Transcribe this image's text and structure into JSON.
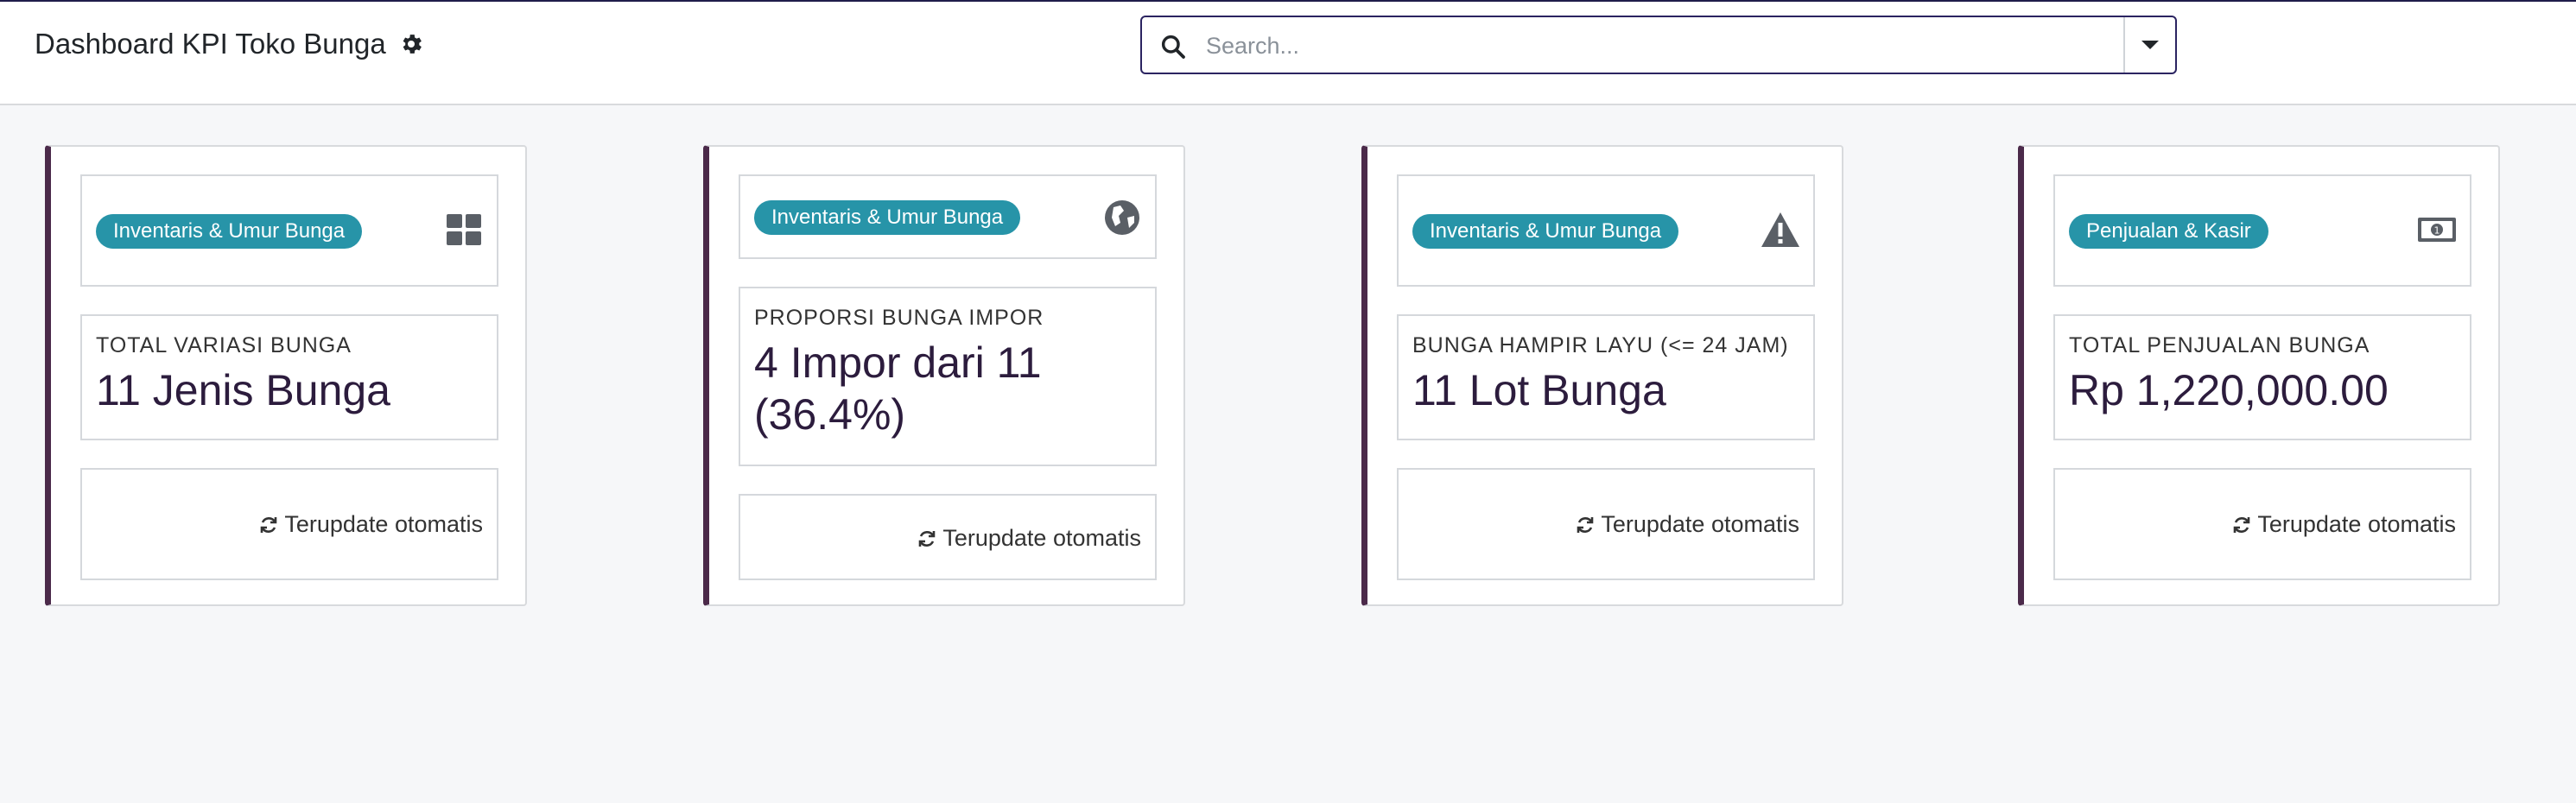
{
  "header": {
    "title": "Dashboard KPI Toko Bunga",
    "settings_icon": "gear-icon"
  },
  "search": {
    "placeholder": "Search...",
    "value": "",
    "icon": "search-icon",
    "toggle_icon": "caret-down-icon"
  },
  "cards": [
    {
      "category": "Inventaris & Umur Bunga",
      "icon": "grid-icon",
      "label": "TOTAL VARIASI BUNGA",
      "value": "11 Jenis Bunga",
      "footer": "Terupdate otomatis"
    },
    {
      "category": "Inventaris & Umur Bunga",
      "icon": "globe-icon",
      "label": "PROPORSI BUNGA IMPOR",
      "value": "4 Impor dari 11 (36.4%)",
      "footer": "Terupdate otomatis"
    },
    {
      "category": "Inventaris & Umur Bunga",
      "icon": "warning-icon",
      "label": "BUNGA HAMPIR LAYU (<= 24 JAM)",
      "value": "11 Lot Bunga",
      "footer": "Terupdate otomatis"
    },
    {
      "category": "Penjualan & Kasir",
      "icon": "money-icon",
      "label": "TOTAL PENJUALAN BUNGA",
      "value": "Rp 1,220,000.00",
      "footer": "Terupdate otomatis"
    }
  ],
  "colors": {
    "accent_border": "#4b2a4a",
    "badge": "#2794a8",
    "value_text": "#2c1c3d",
    "search_border": "#2b2461"
  }
}
